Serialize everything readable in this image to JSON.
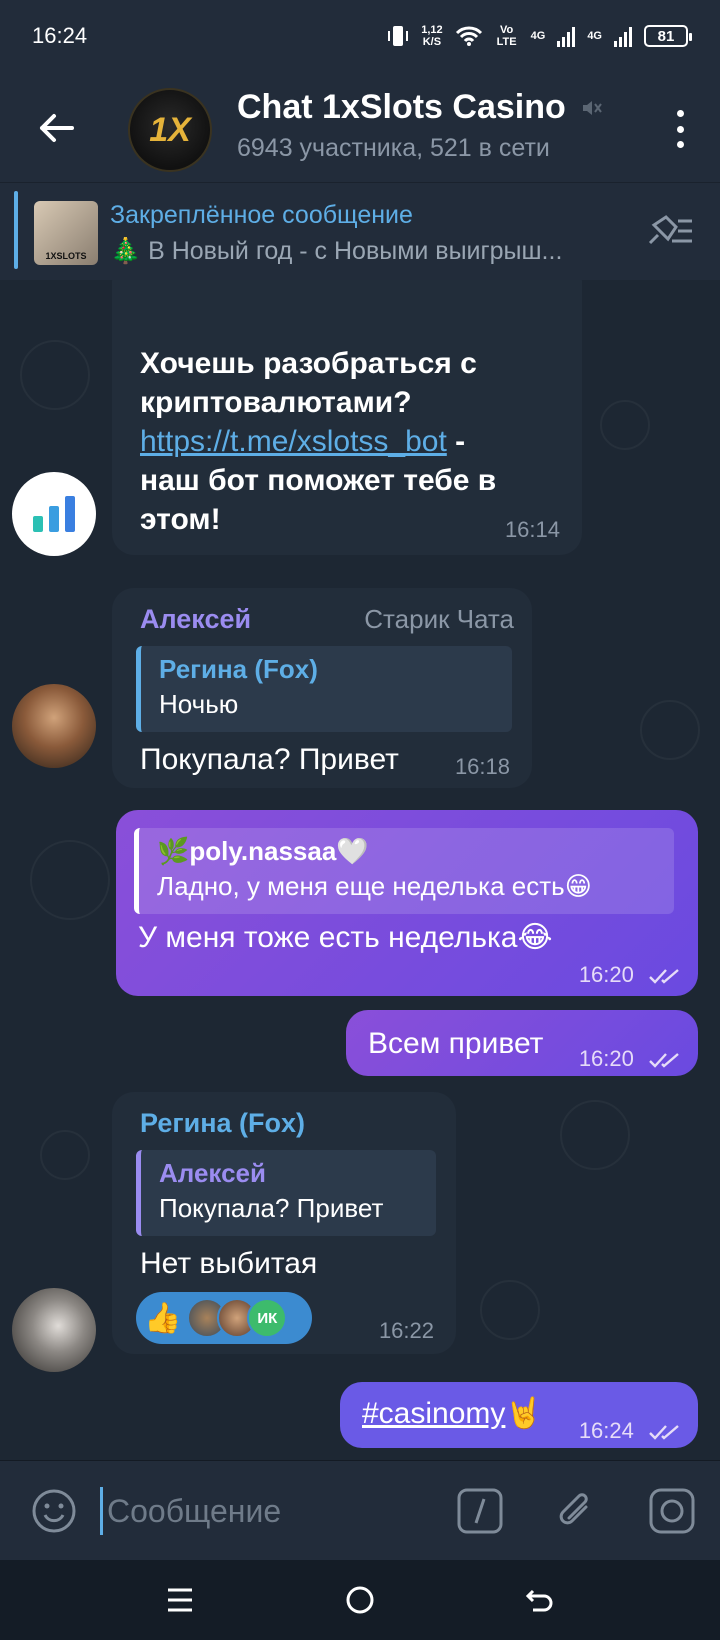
{
  "status": {
    "time": "16:24",
    "speed": "1,12",
    "speed_unit": "K/S",
    "volte": "Vo LTE",
    "net1": "4G",
    "net2": "4G",
    "battery": "81"
  },
  "header": {
    "title": "Chat 1xSlots Casino",
    "avatar_text": "1X",
    "subtitle": "6943 участника, 521 в сети"
  },
  "pinned": {
    "title": "Закреплённое сообщение",
    "text": "🎄 В Новый год - с Новыми выигрыш...",
    "thumb_text": "1XSLOTS"
  },
  "messages": {
    "m1": {
      "line1": "Хочешь разобраться с",
      "line2": "криптовалютами?",
      "link": "https://t.me/xslotss_bot",
      "after_link": " -",
      "line4": "наш бот поможет тебе в",
      "line5": "этом!",
      "time": "16:14"
    },
    "m2": {
      "sender": "Алексей",
      "role": "Старик Чата",
      "quote_name": "Регина (Fox)",
      "quote_text": "Ночью",
      "text": "Покупала? Привет",
      "time": "16:18"
    },
    "m3": {
      "quote_name": "🌿poly.nassaa🤍",
      "quote_text": "Ладно, у меня еще неделька есть😁",
      "text": "У меня тоже есть неделька😂",
      "time": "16:20"
    },
    "m4": {
      "text": "Всем привет",
      "time": "16:20"
    },
    "m5": {
      "sender": "Регина (Fox)",
      "quote_name": "Алексей",
      "quote_text": "Покупала? Привет",
      "text": "Нет выбитая",
      "reaction_emoji": "👍",
      "reaction_initials": "ИК",
      "time": "16:22"
    },
    "m6": {
      "text": "#casinomy",
      "emoji": "🤘",
      "time": "16:24"
    }
  },
  "input": {
    "placeholder": "Сообщение"
  },
  "colors": {
    "accent": "#5eaee6",
    "outgoing": "#7a4ddc",
    "incoming": "#222d3a"
  }
}
